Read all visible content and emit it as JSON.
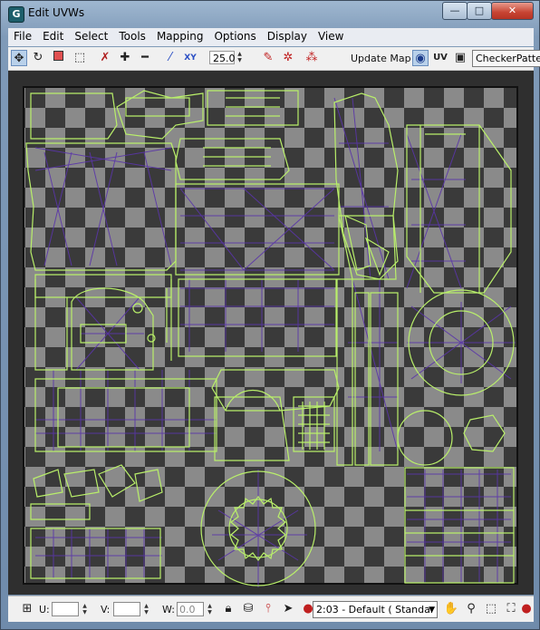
{
  "window": {
    "title": "Edit UVWs",
    "app_icon": "3ds-max-logo",
    "controls": {
      "minimize": "—",
      "maximize": "□",
      "close": "✕"
    }
  },
  "menu": [
    "File",
    "Edit",
    "Select",
    "Tools",
    "Mapping",
    "Options",
    "Display",
    "View"
  ],
  "toolbar": {
    "icons": [
      "move-icon",
      "rotate-icon",
      "scale-icon",
      "freeform-icon",
      "mirror-icon",
      "expand-icon",
      "contract-icon",
      "pen-icon",
      "xy-icon"
    ],
    "angle_value": "25.0",
    "update_map_label": "Update Map",
    "uv_label": "UV",
    "texture_dropdown": "CheckerPatte"
  },
  "statusbar": {
    "u_label": "U:",
    "v_label": "V:",
    "w_label": "W:",
    "w_value": "0.0",
    "dropdown_value": "2:03 - Default  ( Standar"
  },
  "colors": {
    "checker_dark": "#3a3a3a",
    "checker_light": "#8a8a8a",
    "uv_edge": "#b9ef6a",
    "uv_inner": "#5a35a8",
    "title_bar": "#8ca6c2"
  }
}
